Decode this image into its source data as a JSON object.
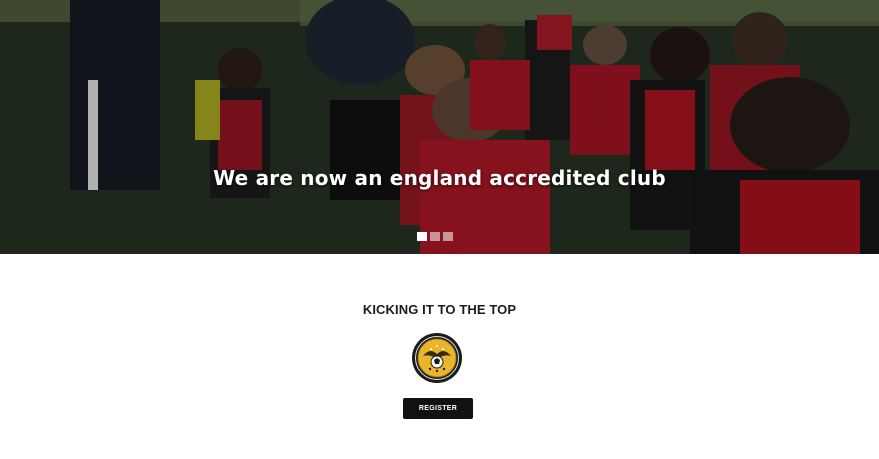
{
  "hero": {
    "heading": "We are now an england accredited club",
    "slider": {
      "slide_count": 3,
      "active_index": 0
    }
  },
  "intro": {
    "tagline": "KICKING IT TO THE TOP"
  },
  "crest": {
    "icon": "club-crest-logo"
  },
  "actions": {
    "register_label": "REGISTER"
  },
  "colors": {
    "hero_text": "#ffffff",
    "button_bg": "#111111",
    "kit_red": "#b8121f",
    "crest_gold": "#d9a520"
  }
}
